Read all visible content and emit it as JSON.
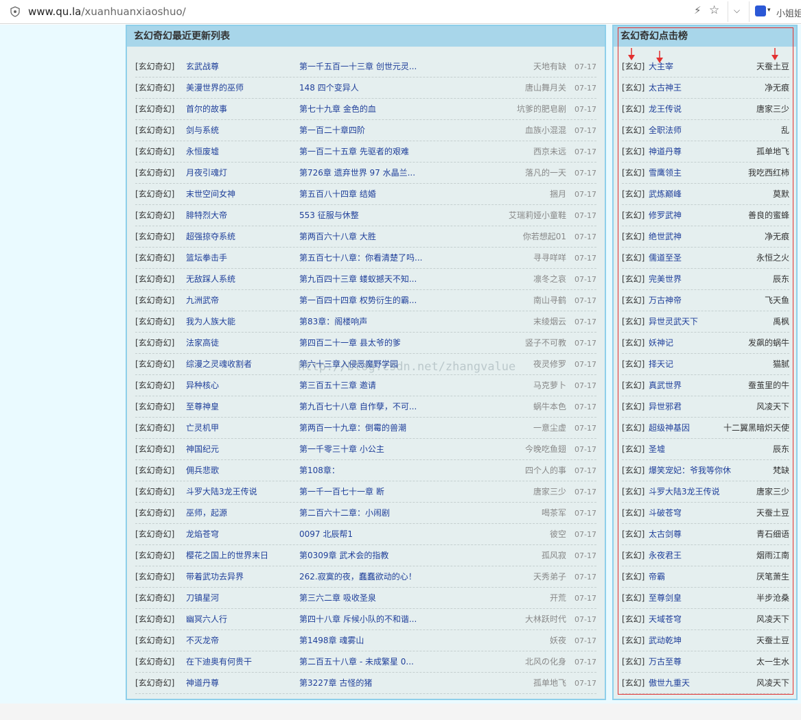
{
  "browser": {
    "url_host": "www.qu.la",
    "url_path": "/xuanhuanxiaoshuo/",
    "user_label": "小姐姐"
  },
  "watermark": "http://blog.csdn.net/zhangvalue",
  "latest": {
    "title": "玄幻奇幻最近更新列表",
    "rows": [
      {
        "cat": "[玄幻奇幻]",
        "title": "玄武战尊",
        "chapter": "第一千五百一十三章 创世元灵...",
        "author": "天地有缺",
        "date": "07-17"
      },
      {
        "cat": "[玄幻奇幻]",
        "title": "美漫世界的巫师",
        "chapter": "148 四个变异人",
        "author": "唐山舞月关",
        "date": "07-17"
      },
      {
        "cat": "[玄幻奇幻]",
        "title": "首尔的故事",
        "chapter": "第七十九章 金色的血",
        "author": "坑爹的肥皂剧",
        "date": "07-17"
      },
      {
        "cat": "[玄幻奇幻]",
        "title": "剑与系统",
        "chapter": "第一百二十章四阶",
        "author": "血族小混混",
        "date": "07-17"
      },
      {
        "cat": "[玄幻奇幻]",
        "title": "永恒废墟",
        "chapter": "第一百二十五章 先驱者的艰难",
        "author": "西京未远",
        "date": "07-17"
      },
      {
        "cat": "[玄幻奇幻]",
        "title": "月夜引魂灯",
        "chapter": "第726章 遗弃世界 97 水晶兰...",
        "author": "落凡的一天",
        "date": "07-17"
      },
      {
        "cat": "[玄幻奇幻]",
        "title": "末世空间女神",
        "chapter": "第五百八十四章 结婚",
        "author": "捆月",
        "date": "07-17"
      },
      {
        "cat": "[玄幻奇幻]",
        "title": "腓特烈大帝",
        "chapter": "553 征服与休整",
        "author": "艾瑞莉娅小童鞋",
        "date": "07-17"
      },
      {
        "cat": "[玄幻奇幻]",
        "title": "超强掠夺系统",
        "chapter": "第两百六十八章 大胜",
        "author": "你若想起01",
        "date": "07-17"
      },
      {
        "cat": "[玄幻奇幻]",
        "title": "篮坛拳击手",
        "chapter": "第五百七十八章：你看清楚了吗...",
        "author": "寻寻咩咩",
        "date": "07-17"
      },
      {
        "cat": "[玄幻奇幻]",
        "title": "无敌踩人系统",
        "chapter": "第九百四十三章 蝼蚁撼天不知...",
        "author": "凛冬之哀",
        "date": "07-17"
      },
      {
        "cat": "[玄幻奇幻]",
        "title": "九洲武帝",
        "chapter": "第一百四十四章 权势衍生的霸...",
        "author": "南山寻鹤",
        "date": "07-17"
      },
      {
        "cat": "[玄幻奇幻]",
        "title": "我为人族大能",
        "chapter": "第83章：阁楼响声",
        "author": "末绫烟云",
        "date": "07-17"
      },
      {
        "cat": "[玄幻奇幻]",
        "title": "法家高徒",
        "chapter": "第四百二十一章 县太爷的爹",
        "author": "竖子不可教",
        "date": "07-17"
      },
      {
        "cat": "[玄幻奇幻]",
        "title": "综漫之灵魂收割者",
        "chapter": "第六十三章入侵恶魔野学园",
        "author": "夜灵修罗",
        "date": "07-17"
      },
      {
        "cat": "[玄幻奇幻]",
        "title": "异种核心",
        "chapter": "第三百五十三章 邀请",
        "author": "马克萝卜",
        "date": "07-17"
      },
      {
        "cat": "[玄幻奇幻]",
        "title": "至尊神皇",
        "chapter": "第九百七十八章 自作孽，不可...",
        "author": "蜗牛本色",
        "date": "07-17"
      },
      {
        "cat": "[玄幻奇幻]",
        "title": "亡灵机甲",
        "chapter": "第两百一十九章：倒霉的兽潮",
        "author": "一意尘虚",
        "date": "07-17"
      },
      {
        "cat": "[玄幻奇幻]",
        "title": "神国纪元",
        "chapter": "第一千零三十章 小公主",
        "author": "今晚吃鱼翅",
        "date": "07-17"
      },
      {
        "cat": "[玄幻奇幻]",
        "title": "佣兵悲歌",
        "chapter": "第108章：",
        "author": "四个人的事",
        "date": "07-17"
      },
      {
        "cat": "[玄幻奇幻]",
        "title": "斗罗大陆3龙王传说",
        "chapter": "第一千一百七十一章 断",
        "author": "唐家三少",
        "date": "07-17"
      },
      {
        "cat": "[玄幻奇幻]",
        "title": "巫师，起源",
        "chapter": "第二百六十二章：小闹剧",
        "author": "喝茶军",
        "date": "07-17"
      },
      {
        "cat": "[玄幻奇幻]",
        "title": "龙焰苍穹",
        "chapter": "0097 北辰帮1",
        "author": "彼空",
        "date": "07-17"
      },
      {
        "cat": "[玄幻奇幻]",
        "title": "樱花之国上的世界末日",
        "chapter": "第0309章 武术会的指教",
        "author": "孤风寂",
        "date": "07-17"
      },
      {
        "cat": "[玄幻奇幻]",
        "title": "带着武功去异界",
        "chapter": "262.寂寞的夜，蠢蠢欲动的心！",
        "author": "天秀弟子",
        "date": "07-17"
      },
      {
        "cat": "[玄幻奇幻]",
        "title": "刀镇星河",
        "chapter": "第三六二章 吸收圣泉",
        "author": "开荒",
        "date": "07-17"
      },
      {
        "cat": "[玄幻奇幻]",
        "title": "幽冥六人行",
        "chapter": "第四十八章 斥候小队的不和谐...",
        "author": "大林跃时代",
        "date": "07-17"
      },
      {
        "cat": "[玄幻奇幻]",
        "title": "不灭龙帝",
        "chapter": "第1498章 魂雾山",
        "author": "妖夜",
        "date": "07-17"
      },
      {
        "cat": "[玄幻奇幻]",
        "title": "在下迪奥有何贵干",
        "chapter": "第二百五十八章 - 未成繁星 0...",
        "author": "北风の化身",
        "date": "07-17"
      },
      {
        "cat": "[玄幻奇幻]",
        "title": "神道丹尊",
        "chapter": "第3227章 古怪的猪",
        "author": "孤单地飞",
        "date": "07-17"
      }
    ]
  },
  "ranking": {
    "title": "玄幻奇幻点击榜",
    "rows": [
      {
        "cat": "[玄幻]",
        "title": "大主宰",
        "author": "天蚕土豆"
      },
      {
        "cat": "[玄幻]",
        "title": "太古神王",
        "author": "净无痕"
      },
      {
        "cat": "[玄幻]",
        "title": "龙王传说",
        "author": "唐家三少"
      },
      {
        "cat": "[玄幻]",
        "title": "全职法师",
        "author": "乱"
      },
      {
        "cat": "[玄幻]",
        "title": "神道丹尊",
        "author": "孤单地飞"
      },
      {
        "cat": "[玄幻]",
        "title": "雪鹰领主",
        "author": "我吃西红柿"
      },
      {
        "cat": "[玄幻]",
        "title": "武炼巅峰",
        "author": "莫默"
      },
      {
        "cat": "[玄幻]",
        "title": "修罗武神",
        "author": "善良的蜜蜂"
      },
      {
        "cat": "[玄幻]",
        "title": "绝世武神",
        "author": "净无痕"
      },
      {
        "cat": "[玄幻]",
        "title": "儒道至圣",
        "author": "永恒之火"
      },
      {
        "cat": "[玄幻]",
        "title": "完美世界",
        "author": "辰东"
      },
      {
        "cat": "[玄幻]",
        "title": "万古神帝",
        "author": "飞天鱼"
      },
      {
        "cat": "[玄幻]",
        "title": "异世灵武天下",
        "author": "禹枫"
      },
      {
        "cat": "[玄幻]",
        "title": "妖神记",
        "author": "发飙的蜗牛"
      },
      {
        "cat": "[玄幻]",
        "title": "择天记",
        "author": "猫腻"
      },
      {
        "cat": "[玄幻]",
        "title": "真武世界",
        "author": "蚕茧里的牛"
      },
      {
        "cat": "[玄幻]",
        "title": "异世邪君",
        "author": "风凌天下"
      },
      {
        "cat": "[玄幻]",
        "title": "超级神基因",
        "author": "十二翼黑暗炽天使"
      },
      {
        "cat": "[玄幻]",
        "title": "圣墟",
        "author": "辰东"
      },
      {
        "cat": "[玄幻]",
        "title": "爆笑宠妃：爷我等你休妻",
        "author": "梵缺"
      },
      {
        "cat": "[玄幻]",
        "title": "斗罗大陆3龙王传说",
        "author": "唐家三少"
      },
      {
        "cat": "[玄幻]",
        "title": "斗破苍穹",
        "author": "天蚕土豆"
      },
      {
        "cat": "[玄幻]",
        "title": "太古剑尊",
        "author": "青石细语"
      },
      {
        "cat": "[玄幻]",
        "title": "永夜君王",
        "author": "烟雨江南"
      },
      {
        "cat": "[玄幻]",
        "title": "帝霸",
        "author": "厌笔萧生"
      },
      {
        "cat": "[玄幻]",
        "title": "至尊剑皇",
        "author": "半步沧桑"
      },
      {
        "cat": "[玄幻]",
        "title": "天域苍穹",
        "author": "风凌天下"
      },
      {
        "cat": "[玄幻]",
        "title": "武动乾坤",
        "author": "天蚕土豆"
      },
      {
        "cat": "[玄幻]",
        "title": "万古至尊",
        "author": "太一生水"
      },
      {
        "cat": "[玄幻]",
        "title": "傲世九重天",
        "author": "风凌天下"
      }
    ]
  },
  "colors": {
    "header_bg": "#a8d6ea",
    "box_border": "#8ecfea",
    "box_bg": "#e5efef",
    "page_bg": "#eafaff",
    "link": "#1f3f9a",
    "annotation_red": "#e23030"
  }
}
